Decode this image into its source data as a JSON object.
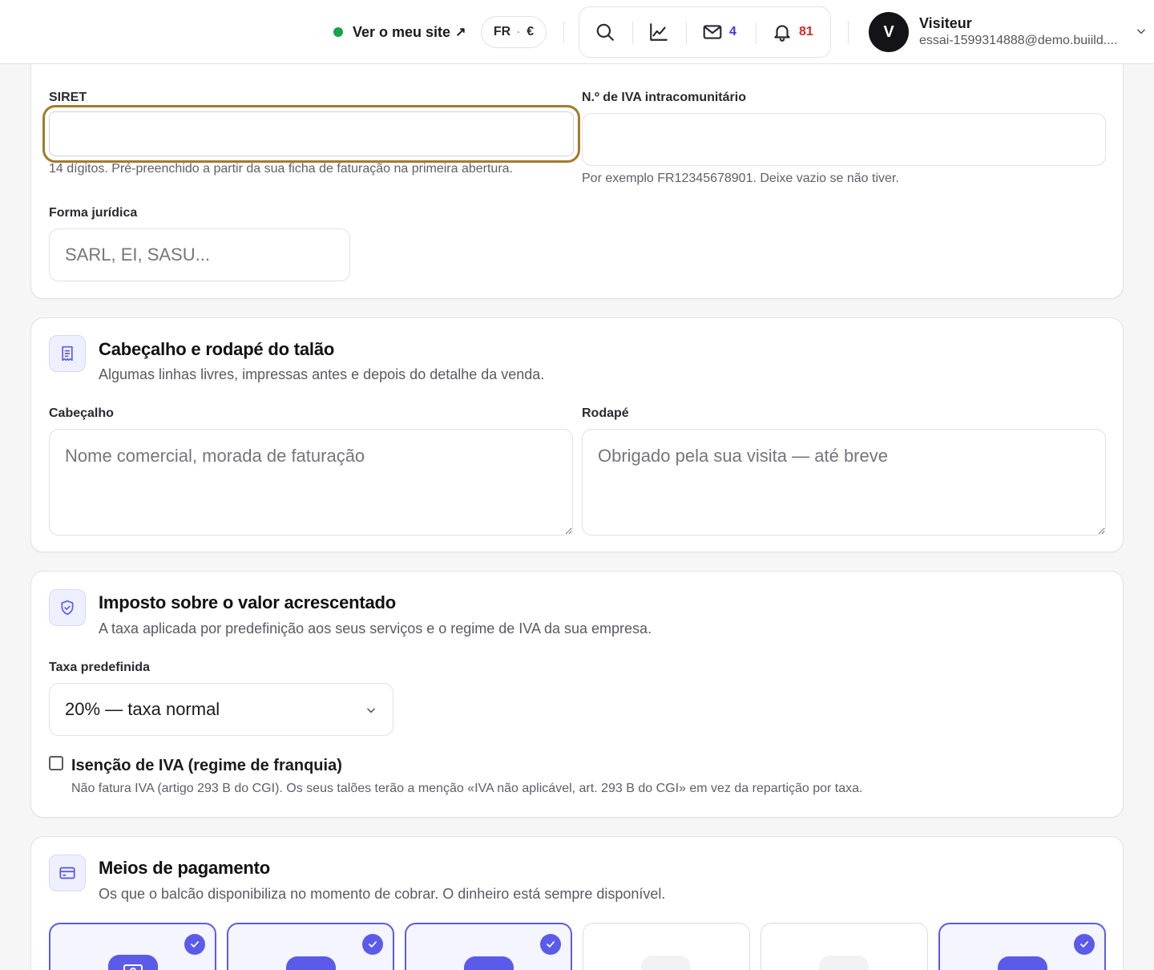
{
  "topbar": {
    "site_link_label": "Ver o meu site",
    "site_link_arrow": "↗",
    "site_status_color": "#16a34a",
    "locale": "FR",
    "locale_sep": "·",
    "currency": "€",
    "tools": [
      {
        "name": "search",
        "icon": "search-icon"
      },
      {
        "name": "stats",
        "icon": "chart-line-icon"
      },
      {
        "name": "messages",
        "icon": "mail-icon",
        "count": "4",
        "color": "#3b3bd6"
      },
      {
        "name": "notifications",
        "icon": "bell-icon",
        "count": "81",
        "color": "#dc2626"
      }
    ],
    "user": {
      "initial": "V",
      "name": "Visiteur",
      "email": "essai-1599314888@demo.buiild...."
    }
  },
  "company": {
    "siret_label": "SIRET",
    "siret_value": "",
    "siret_hint": "14 dígitos. Pré-preenchido a partir da sua ficha de faturação na primeira abertura.",
    "vat_label": "N.º de IVA intracomunitário",
    "vat_value": "",
    "vat_hint": "Por exemplo FR12345678901. Deixe vazio se não tiver.",
    "legal_form_label": "Forma jurídica",
    "legal_form_placeholder": "SARL, EI, SASU..."
  },
  "receipt": {
    "icon": "receipt-icon",
    "title": "Cabeçalho e rodapé do talão",
    "subtitle": "Algumas linhas livres, impressas antes e depois do detalhe da venda.",
    "header_label": "Cabeçalho",
    "header_placeholder": "Nome comercial, morada de faturação",
    "footer_label": "Rodapé",
    "footer_placeholder": "Obrigado pela sua visita — até breve"
  },
  "vat": {
    "icon": "shield-check-icon",
    "title": "Imposto sobre o valor acrescentado",
    "subtitle": "A taxa aplicada por predefinição aos seus serviços e o regime de IVA da sua empresa.",
    "default_rate_label": "Taxa predefinida",
    "default_rate_value": "20% — taxa normal",
    "exemption_label": "Isenção de IVA (regime de franquia)",
    "exemption_checked": false,
    "exemption_hint": "Não fatura IVA (artigo 293 B do CGI). Os seus talões terão a menção «IVA não aplicável, art. 293 B do CGI» em vez da repartição por taxa."
  },
  "payments": {
    "icon": "credit-card-icon",
    "title": "Meios de pagamento",
    "subtitle": "Os que o balcão disponibiliza no momento de cobrar. O dinheiro está sempre disponível.",
    "accent": "#5b5bea",
    "methods": [
      {
        "selected": true,
        "icon": "cash-icon"
      },
      {
        "selected": true,
        "icon": "payment-method-icon"
      },
      {
        "selected": true,
        "icon": "payment-method-icon"
      },
      {
        "selected": false,
        "icon": "payment-method-icon"
      },
      {
        "selected": false,
        "icon": "payment-method-icon"
      },
      {
        "selected": true,
        "icon": "payment-method-icon"
      }
    ]
  }
}
